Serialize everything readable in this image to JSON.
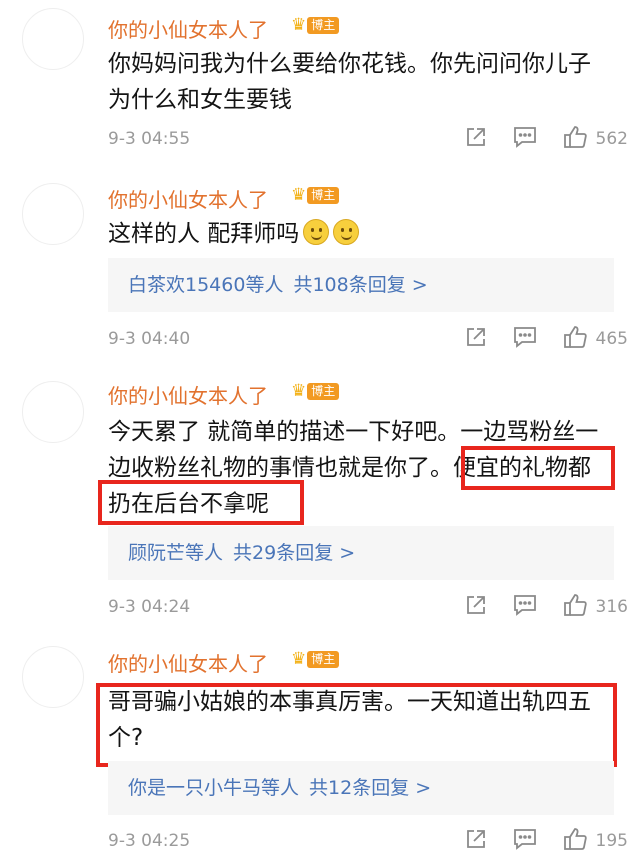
{
  "comments": [
    {
      "username": "你的小仙女本人了",
      "badge": "博主",
      "lines": [
        "你妈妈问我为什么要给你花钱。你先问问你儿子",
        "为什么和女生要钱"
      ],
      "time": "9-3 04:55",
      "likes": "562"
    },
    {
      "username": "你的小仙女本人了",
      "badge": "博主",
      "lines": [
        "这样的人 配拜师吗"
      ],
      "replies": {
        "who": "白茶欢15460等人",
        "total": "共108条回复 >"
      },
      "time": "9-3 04:40",
      "likes": "465"
    },
    {
      "username": "你的小仙女本人了",
      "badge": "博主",
      "lines": [
        "今天累了 就简单的描述一下好吧。一边骂粉丝一",
        "边收粉丝礼物的事情也就是你了。便宜的礼物都",
        "扔在后台不拿呢"
      ],
      "replies": {
        "who": "顾阮芒等人",
        "total": "共29条回复 >"
      },
      "time": "9-3 04:24",
      "likes": "316"
    },
    {
      "username": "你的小仙女本人了",
      "badge": "博主",
      "lines": [
        "哥哥骗小姑娘的本事真厉害。一天知道出轨四五",
        "个?"
      ],
      "replies": {
        "who": "你是一只小牛马等人",
        "total": "共12条回复 >"
      },
      "time": "9-3 04:25",
      "likes": "195"
    }
  ],
  "colors": {
    "username": "#e2722e",
    "link": "#4a75b8",
    "highlight": "#e8261d",
    "meta": "#9a9a9a"
  },
  "icons": [
    "share-icon",
    "comment-icon",
    "like-icon",
    "smile-emoji",
    "crown-icon"
  ]
}
